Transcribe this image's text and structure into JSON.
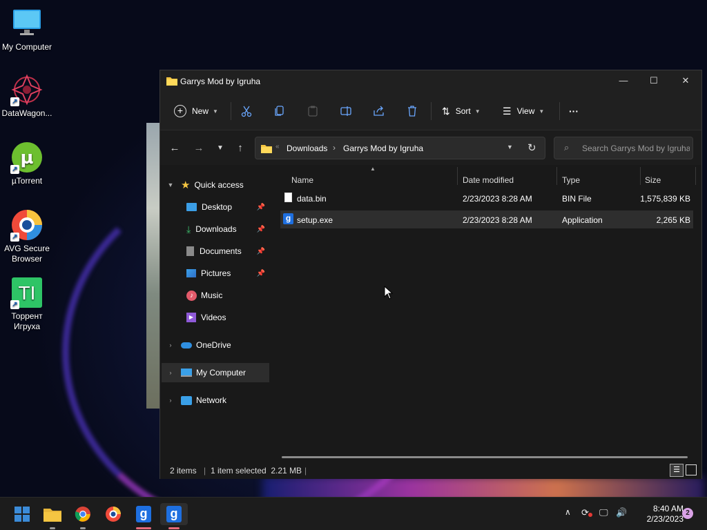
{
  "desktop": {
    "icons": [
      {
        "label": "My Computer"
      },
      {
        "label": "DataWagon..."
      },
      {
        "label": "µTorrent"
      },
      {
        "label": "AVG Secure Browser"
      },
      {
        "label": "Торрент Игруха",
        "glyph": "TI"
      }
    ]
  },
  "window": {
    "title": "Garrys Mod by Igruha",
    "controls": {
      "minimize": "—",
      "maximize": "☐",
      "close": "✕"
    }
  },
  "toolbar": {
    "new_label": "New",
    "sort_label": "Sort",
    "view_label": "View",
    "more_label": "···"
  },
  "address": {
    "overflow": "«",
    "crumbs": [
      "Downloads",
      "Garrys Mod by Igruha"
    ],
    "separator": "›",
    "search_placeholder": "Search Garrys Mod by Igruha"
  },
  "nav_pane": {
    "quick_access": "Quick access",
    "items": [
      {
        "label": "Desktop",
        "pinned": true
      },
      {
        "label": "Downloads",
        "pinned": true
      },
      {
        "label": "Documents",
        "pinned": true
      },
      {
        "label": "Pictures",
        "pinned": true
      },
      {
        "label": "Music",
        "pinned": false
      },
      {
        "label": "Videos",
        "pinned": false
      }
    ],
    "onedrive": "OneDrive",
    "my_computer": "My Computer",
    "network": "Network"
  },
  "columns": {
    "name": "Name",
    "date": "Date modified",
    "type": "Type",
    "size": "Size"
  },
  "files": [
    {
      "name": "data.bin",
      "date": "2/23/2023 8:28 AM",
      "type": "BIN File",
      "size": "1,575,839 KB",
      "selected": false
    },
    {
      "name": "setup.exe",
      "date": "2/23/2023 8:28 AM",
      "type": "Application",
      "size": "2,265 KB",
      "selected": true
    }
  ],
  "status": {
    "items": "2 items",
    "selection": "1 item selected  2.21 MB",
    "divider": "|"
  },
  "taskbar": {
    "time": "8:40 AM",
    "date": "2/23/2023",
    "notifications": "2",
    "app_glyph": "g"
  },
  "colors": {
    "accent_blue": "#3b8bd8",
    "folder_yellow": "#f4c542",
    "garrys_blue": "#1e6fe0"
  }
}
